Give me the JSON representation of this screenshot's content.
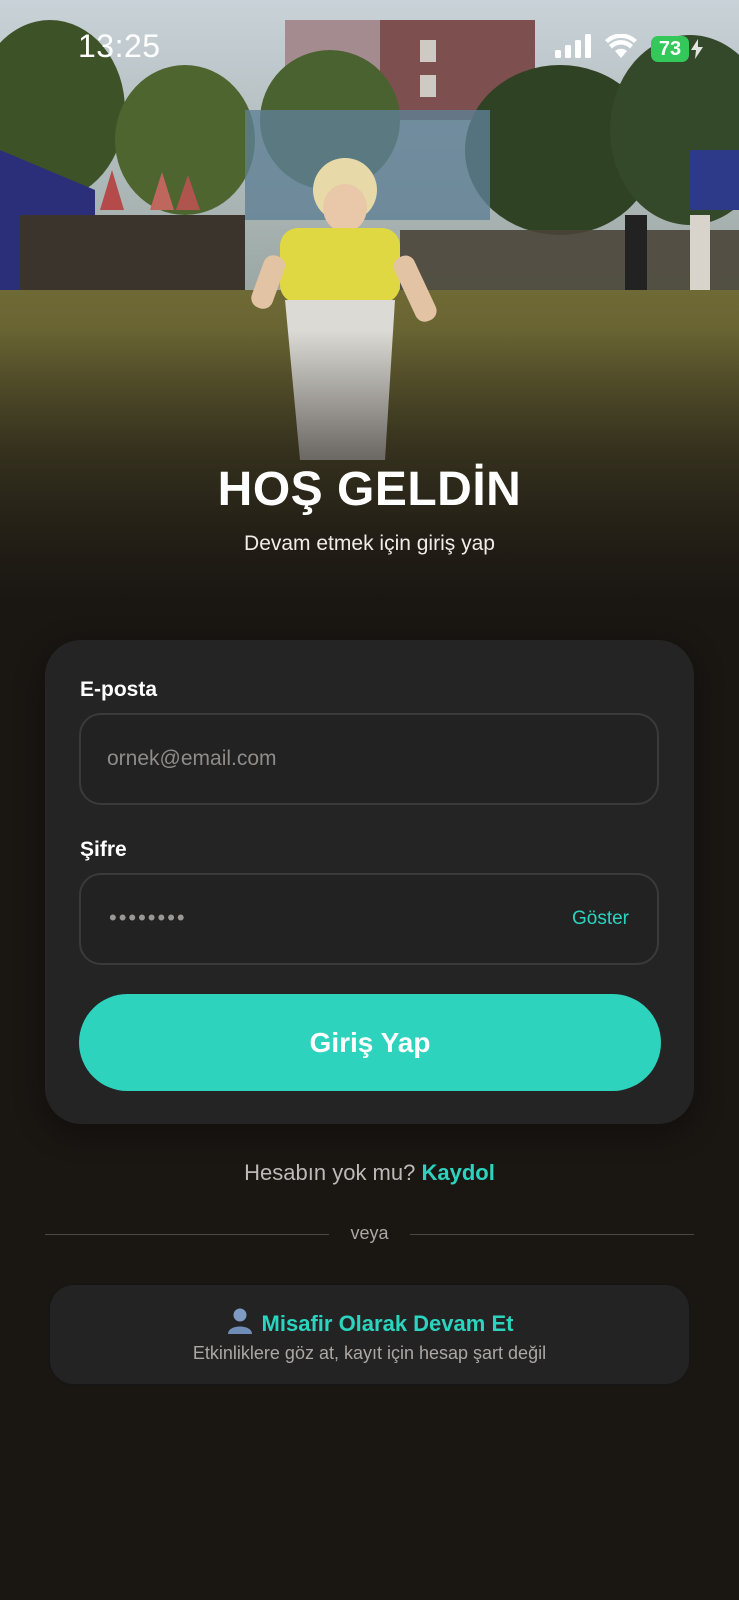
{
  "status_bar": {
    "time": "13:25",
    "battery": "73",
    "icons": [
      "cellular-signal-icon",
      "wifi-icon",
      "battery-icon",
      "charging-bolt-icon"
    ]
  },
  "hero": {
    "image": "hero-photo-child-sack-race"
  },
  "header": {
    "title": "HOŞ GELDİN",
    "subtitle": "Devam etmek için giriş yap"
  },
  "login_form": {
    "email_label": "E-posta",
    "email_placeholder": "ornek@email.com",
    "email_value": "",
    "password_label": "Şifre",
    "password_masked": "••••••••",
    "show_label": "Göster",
    "submit_label": "Giriş Yap"
  },
  "signup": {
    "question": "Hesabın yok mu?",
    "link": "Kaydol"
  },
  "divider": {
    "text": "veya"
  },
  "guest": {
    "icon": "person-icon",
    "title": "Misafir Olarak Devam Et",
    "subtitle": "Etkinliklere göz at, kayıt için hesap şart değil"
  },
  "colors": {
    "accent": "#2ed3be",
    "background": "#1a1612",
    "card": "#252424",
    "battery": "#34c759"
  }
}
